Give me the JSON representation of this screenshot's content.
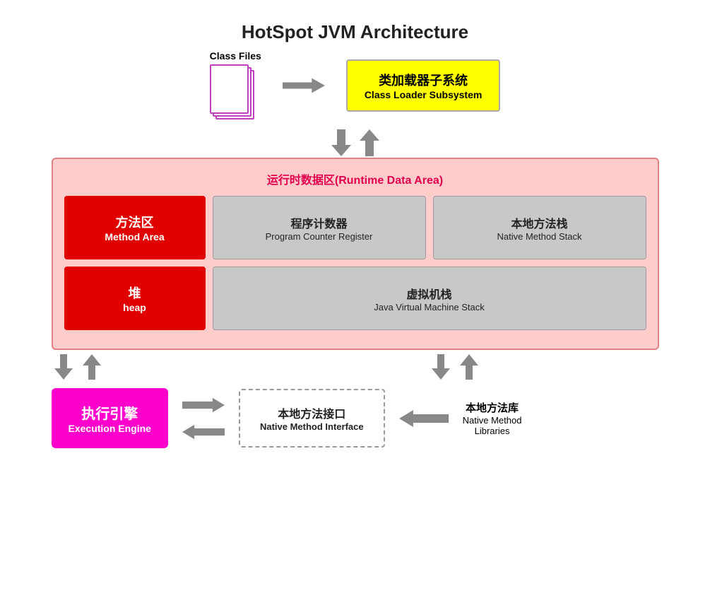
{
  "title": "HotSpot JVM Architecture",
  "class_files_label": "Class Files",
  "class_loader": {
    "zh": "类加载器子系统",
    "en": "Class Loader Subsystem"
  },
  "runtime_area": {
    "label_zh": "运行时数据区(Runtime Data Area)",
    "method_area": {
      "zh": "方法区",
      "en": "Method Area"
    },
    "heap": {
      "zh": "堆",
      "en": "heap"
    },
    "program_counter": {
      "zh": "程序计数器",
      "en": "Program Counter Register"
    },
    "native_method_stack": {
      "zh": "本地方法栈",
      "en": "Native Method Stack"
    },
    "jvm_stack": {
      "zh": "虚拟机栈",
      "en": "Java Virtual Machine Stack"
    }
  },
  "execution_engine": {
    "zh": "执行引擎",
    "en": "Execution Engine"
  },
  "native_method_interface": {
    "zh": "本地方法接口",
    "en": "Native Method Interface"
  },
  "native_libraries": {
    "zh": "本地方法库",
    "en": "Native Method\nLibraries"
  }
}
